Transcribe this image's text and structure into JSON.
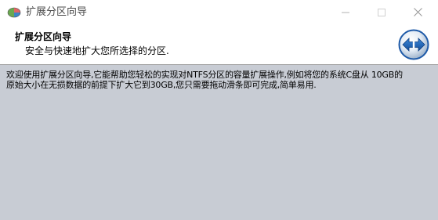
{
  "window": {
    "title": "扩展分区向导",
    "app_icon": "partition-tool-icon",
    "controls": {
      "minimize_icon": "minimize-icon",
      "maximize_icon": "maximize-icon",
      "close_icon": "close-icon"
    }
  },
  "header": {
    "title": "扩展分区向导",
    "subtitle": "安全与快速地扩大您所选择的分区.",
    "icon": "double-arrow-resize-icon"
  },
  "body": {
    "description": "欢迎使用扩展分区向导,它能帮助您轻松的实现对NTFS分区的容量扩展操作,例如将您的系统C盘从 10GB的原始大小在无损数据的前提下扩大它到30GB,您只需要拖动滑条即可完成,简单易用."
  },
  "colors": {
    "body_background": "#c8ccd4",
    "header_background": "#ffffff",
    "accent_blue": "#1e63b8"
  }
}
